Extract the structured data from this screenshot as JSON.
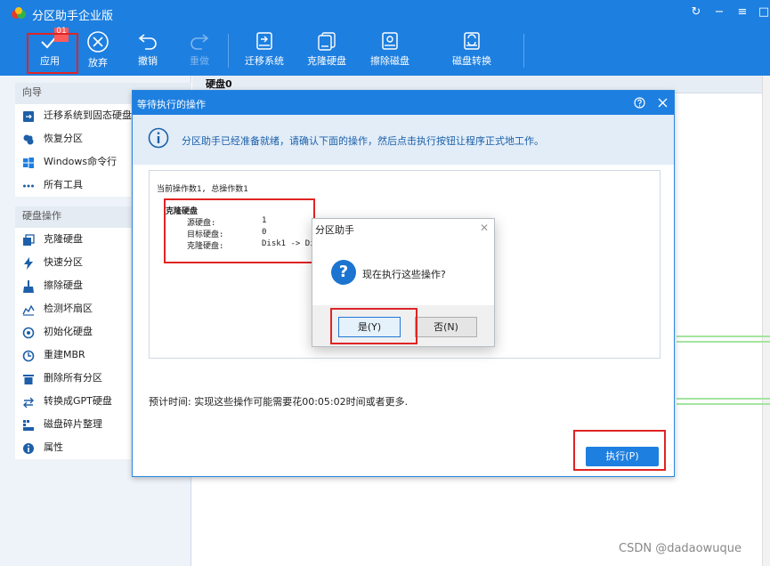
{
  "app": {
    "title": "分区助手企业版",
    "window_controls": [
      "↻",
      "−",
      "≡",
      "−",
      "□"
    ]
  },
  "toolbar": {
    "apply_label": "应用",
    "apply_badge": "01",
    "discard_label": "放弃",
    "undo_label": "撤销",
    "redo_label": "重做",
    "migrate_label": "迁移系统",
    "clone_label": "克隆硬盘",
    "wipe_label": "擦除磁盘",
    "convert_label": "磁盘转换"
  },
  "sidebar": {
    "wizard_header": "向导",
    "wizard_items": [
      {
        "label": "迁移系统到固态硬盘",
        "icon": "migrate-icon"
      },
      {
        "label": "恢复分区",
        "icon": "recover-icon"
      },
      {
        "label": "Windows命令行",
        "icon": "windows-icon"
      },
      {
        "label": "所有工具",
        "icon": "more-icon"
      }
    ],
    "disk_header": "硬盘操作",
    "disk_items": [
      {
        "label": "克隆硬盘",
        "icon": "clone-icon"
      },
      {
        "label": "快速分区",
        "icon": "lightning-icon"
      },
      {
        "label": "擦除硬盘",
        "icon": "broom-icon"
      },
      {
        "label": "检测坏扇区",
        "icon": "chart-icon"
      },
      {
        "label": "初始化硬盘",
        "icon": "init-icon"
      },
      {
        "label": "重建MBR",
        "icon": "mbr-icon"
      },
      {
        "label": "删除所有分区",
        "icon": "trash-icon"
      },
      {
        "label": "转换成GPT硬盘",
        "icon": "convert-icon"
      },
      {
        "label": "磁盘碎片整理",
        "icon": "defrag-icon"
      },
      {
        "label": "属性",
        "icon": "info-icon"
      }
    ]
  },
  "main": {
    "disk_title": "硬盘0"
  },
  "pending_dialog": {
    "title": "等待执行的操作",
    "banner_text": "分区助手已经准备就绪，请确认下面的操作，然后点击执行按钮让程序正式地工作。",
    "op_count": "当前操作数1, 总操作数1",
    "op_title": "克隆硬盘",
    "op_rows": [
      {
        "k": "源硬盘:",
        "v": "1"
      },
      {
        "k": "目标硬盘:",
        "v": "0"
      },
      {
        "k": "克隆硬盘:",
        "v": "Disk1 -> Di"
      }
    ],
    "estimate": "预计时间: 实现这些操作可能需要花00:05:02时间或者更多.",
    "execute_label": "执行(P)"
  },
  "confirm_dialog": {
    "title": "分区助手",
    "message": "现在执行这些操作?",
    "yes_label": "是(Y)",
    "no_label": "否(N)"
  },
  "watermark": "CSDN @dadaowuque",
  "colors": {
    "accent": "#1d7fe0",
    "highlight_red": "#e02424",
    "partition_green": "#a4e5a0"
  }
}
